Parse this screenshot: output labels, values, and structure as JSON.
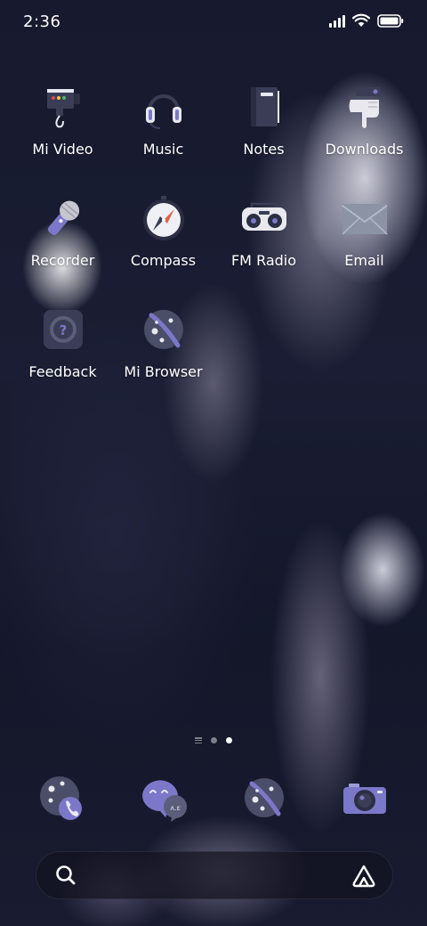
{
  "status_bar": {
    "time": "2:36",
    "icons": [
      "signal-icon",
      "wifi-icon",
      "battery-icon"
    ]
  },
  "apps": [
    {
      "label": "Mi Video",
      "icon": "video-camera-icon"
    },
    {
      "label": "Music",
      "icon": "headphones-icon"
    },
    {
      "label": "Notes",
      "icon": "notebook-icon"
    },
    {
      "label": "Downloads",
      "icon": "downloads-icon"
    },
    {
      "label": "Recorder",
      "icon": "microphone-icon"
    },
    {
      "label": "Compass",
      "icon": "compass-icon"
    },
    {
      "label": "FM Radio",
      "icon": "radio-icon"
    },
    {
      "label": "Email",
      "icon": "envelope-icon"
    },
    {
      "label": "Feedback",
      "icon": "feedback-icon"
    },
    {
      "label": "Mi Browser",
      "icon": "planet-icon"
    }
  ],
  "page_indicator": {
    "pages": 2,
    "active_page": 2
  },
  "dock": [
    {
      "icon": "phone-icon"
    },
    {
      "icon": "messages-icon"
    },
    {
      "icon": "browser-icon"
    },
    {
      "icon": "camera-icon"
    }
  ],
  "search": {
    "icons": [
      "search-icon",
      "assistant-icon"
    ]
  },
  "colors": {
    "accent_purple": "#7b78c9",
    "icon_dark": "#3b3f59",
    "background": "#171a2e"
  }
}
